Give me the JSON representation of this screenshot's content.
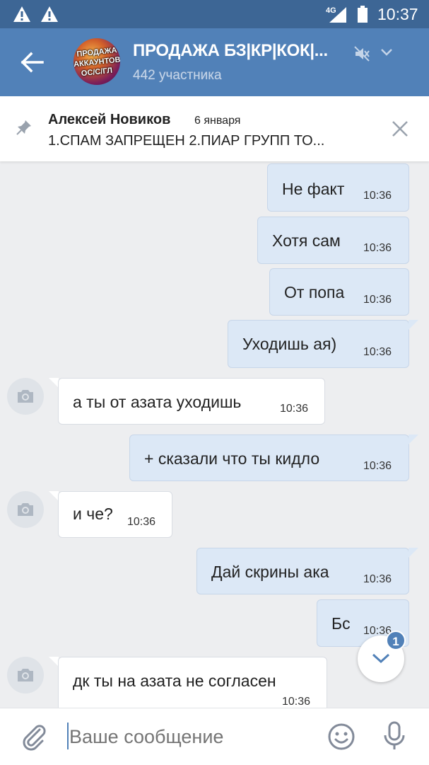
{
  "status_bar": {
    "network": "4G",
    "time": "10:37"
  },
  "header": {
    "title": "ПРОДАЖА БЗ|КР|КОК|...",
    "subtitle": "442 участника",
    "avatar_lines": [
      "ПРОДАЖА",
      "АККАУНТОВ",
      "ОС/С/ГЛ"
    ]
  },
  "pinned": {
    "author": "Алексей Новиков",
    "date": "6 января",
    "text": "1.СПАМ ЗАПРЕЩЕН  2.ПИАР ГРУПП ТО..."
  },
  "messages": [
    {
      "text": "Не факт",
      "time": "10:36",
      "direction": "out"
    },
    {
      "text": "Хотя сам",
      "time": "10:36",
      "direction": "out"
    },
    {
      "text": "От попа",
      "time": "10:36",
      "direction": "out"
    },
    {
      "text": "Уходишь ая)",
      "time": "10:36",
      "direction": "out"
    },
    {
      "text": "а ты от азата уходишь",
      "time": "10:36",
      "direction": "in"
    },
    {
      "text": "+ сказали что ты кидло",
      "time": "10:36",
      "direction": "out"
    },
    {
      "text": "и че?",
      "time": "10:36",
      "direction": "in"
    },
    {
      "text": "Дай скрины ака",
      "time": "10:36",
      "direction": "out"
    },
    {
      "text": "Бс",
      "time": "10:36",
      "direction": "out"
    },
    {
      "text": "дк ты на азата не согласен",
      "time": "10:36",
      "direction": "in"
    }
  ],
  "scroll_down": {
    "badge": "1"
  },
  "composer": {
    "placeholder": "Ваше сообщение"
  },
  "colors": {
    "status_bar": "#3d6695",
    "header": "#5181b8",
    "background": "#edeef0",
    "outgoing_bubble": "#dce8f6",
    "incoming_bubble": "#ffffff"
  }
}
